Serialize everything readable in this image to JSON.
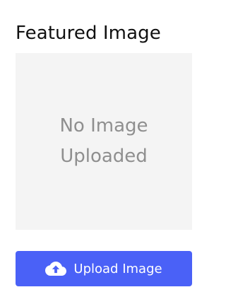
{
  "featured_image": {
    "title": "Featured Image",
    "placeholder": {
      "line1": "No Image",
      "line2": "Uploaded"
    },
    "upload_button": {
      "label": "Upload Image",
      "icon": "cloud-upload-icon",
      "color": "#4a61f7"
    },
    "placeholder_background": "#f4f4f4"
  }
}
